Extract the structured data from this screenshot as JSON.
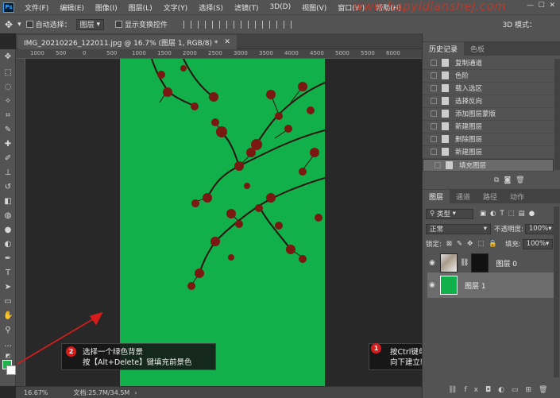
{
  "menubar": {
    "items": [
      "文件(F)",
      "编辑(E)",
      "图像(I)",
      "图层(L)",
      "文字(Y)",
      "选择(S)",
      "滤镜(T)",
      "3D(D)",
      "视图(V)",
      "窗口(W)",
      "帮助(H)"
    ],
    "watermark": "www.hapyidianshej.com"
  },
  "options": {
    "auto_select_label": "自动选择：",
    "auto_select_value": "图层",
    "show_transform_label": "显示变换控件",
    "mode_3d": "3D 模式："
  },
  "document": {
    "tab_title": "IMG_20210226_122011.jpg @ 16.7% (图层 1, RGB/8) *",
    "zoom": "16.67%",
    "doc_size": "文档:25.7M/34.5M"
  },
  "ruler": {
    "top_ticks": [
      "1000",
      "500",
      "0",
      "500",
      "1000",
      "1500",
      "2000",
      "2500",
      "3000",
      "3500",
      "4000",
      "4500",
      "5000",
      "5500",
      "6000"
    ]
  },
  "callouts": {
    "left_badge": "2",
    "left_line1": "选择一个绿色背景",
    "left_line2": "按【Alt+Delete】键填充前景色",
    "right_badge": "1",
    "right_line1": "按Ctrl键单击【创建新图层】图标",
    "right_line2": "向下建立新图层"
  },
  "history": {
    "tabs": [
      "历史记录",
      "色板"
    ],
    "items": [
      "复制通道",
      "色阶",
      "载入选区",
      "选择反向",
      "添加图层蒙版",
      "新建图层",
      "删除图层",
      "新建图层",
      "填充图层"
    ]
  },
  "layers_panel": {
    "tabs": [
      "图层",
      "通道",
      "路径",
      "动作"
    ],
    "filter_kind": "类型",
    "blend_mode": "正常",
    "opacity_label": "不透明度:",
    "opacity_value": "100%",
    "lock_label": "锁定:",
    "fill_label": "填充:",
    "fill_value": "100%",
    "layers": [
      {
        "name": "图层 0",
        "selected": false
      },
      {
        "name": "图层 1",
        "selected": true
      }
    ]
  },
  "colors": {
    "canvas_green": "#12b04a",
    "annotation_red": "#d81b1b",
    "panel_bg": "#535353"
  }
}
